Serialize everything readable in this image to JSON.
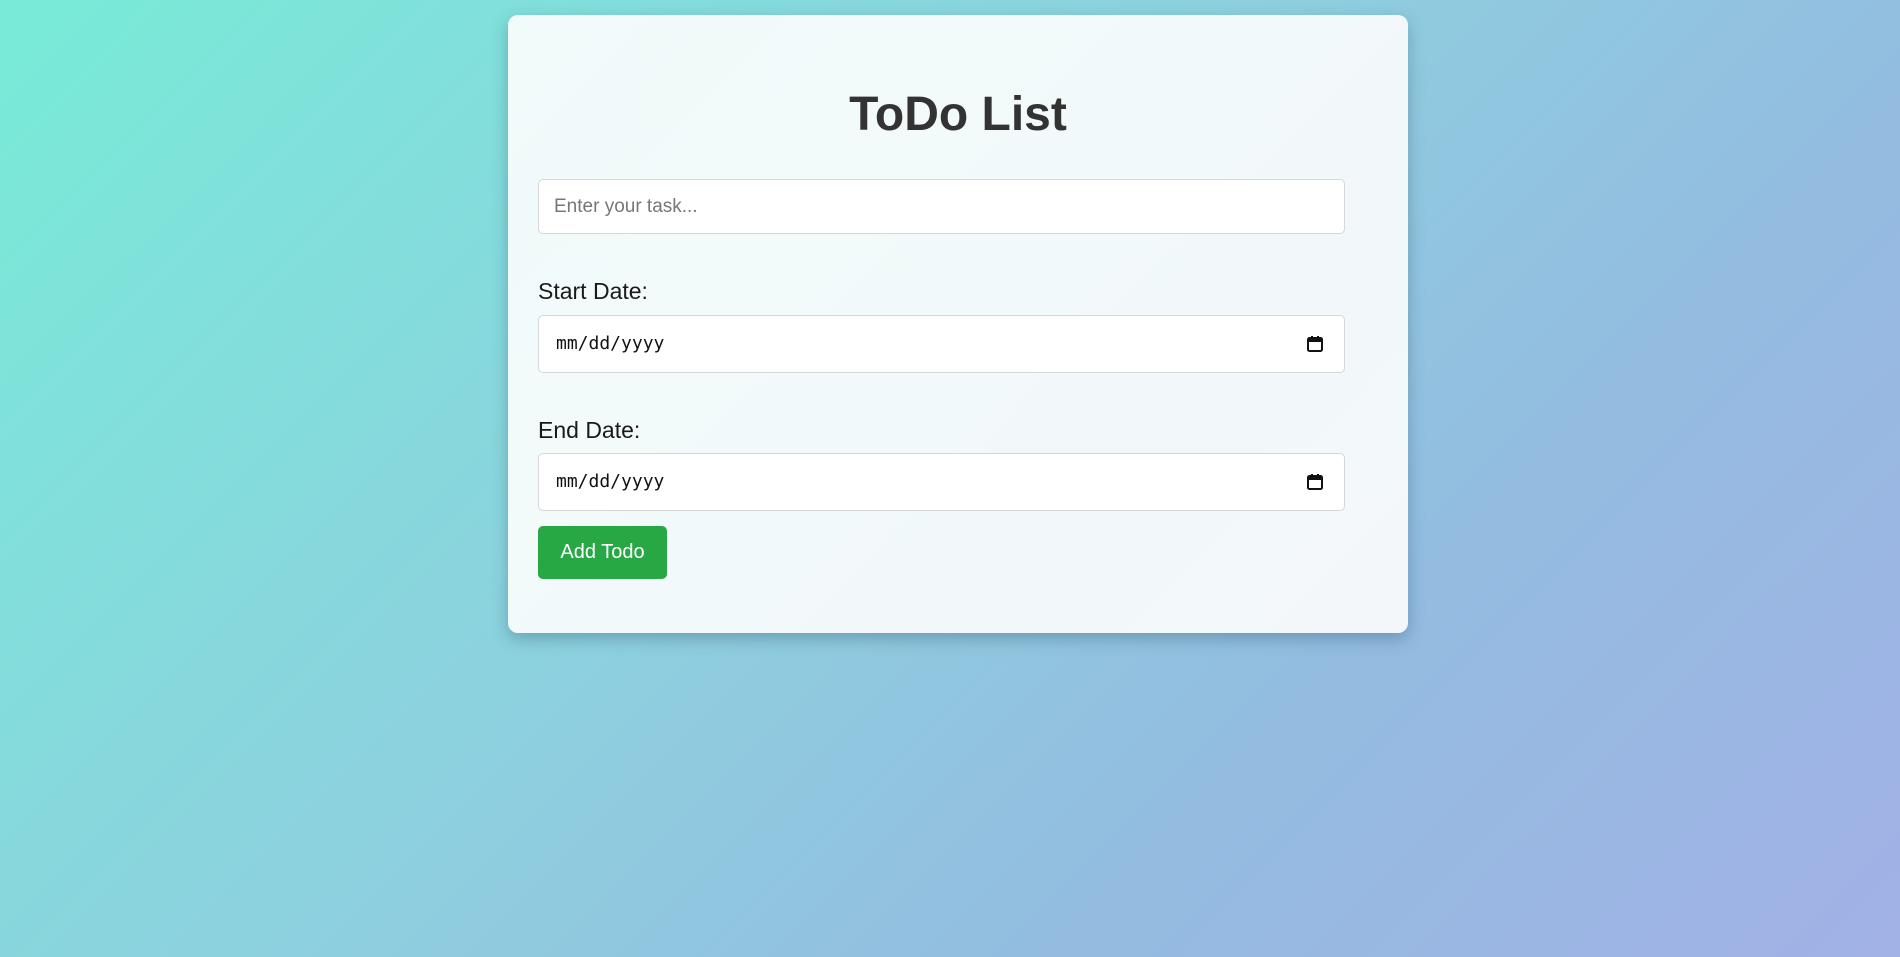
{
  "page": {
    "title": "ToDo List"
  },
  "form": {
    "task_placeholder": "Enter your task...",
    "task_value": "",
    "start_label": "Start Date:",
    "start_value": "mm/dd/yyyy",
    "end_label": "End Date:",
    "end_value": "mm/dd/yyyy",
    "add_button_label": "Add Todo"
  },
  "icons": {
    "date_picker": "calendar-icon"
  },
  "colors": {
    "accent_button": "#28a745",
    "title_text": "#333333",
    "background_start": "#78ebd7",
    "background_end": "#a2b1e6"
  }
}
